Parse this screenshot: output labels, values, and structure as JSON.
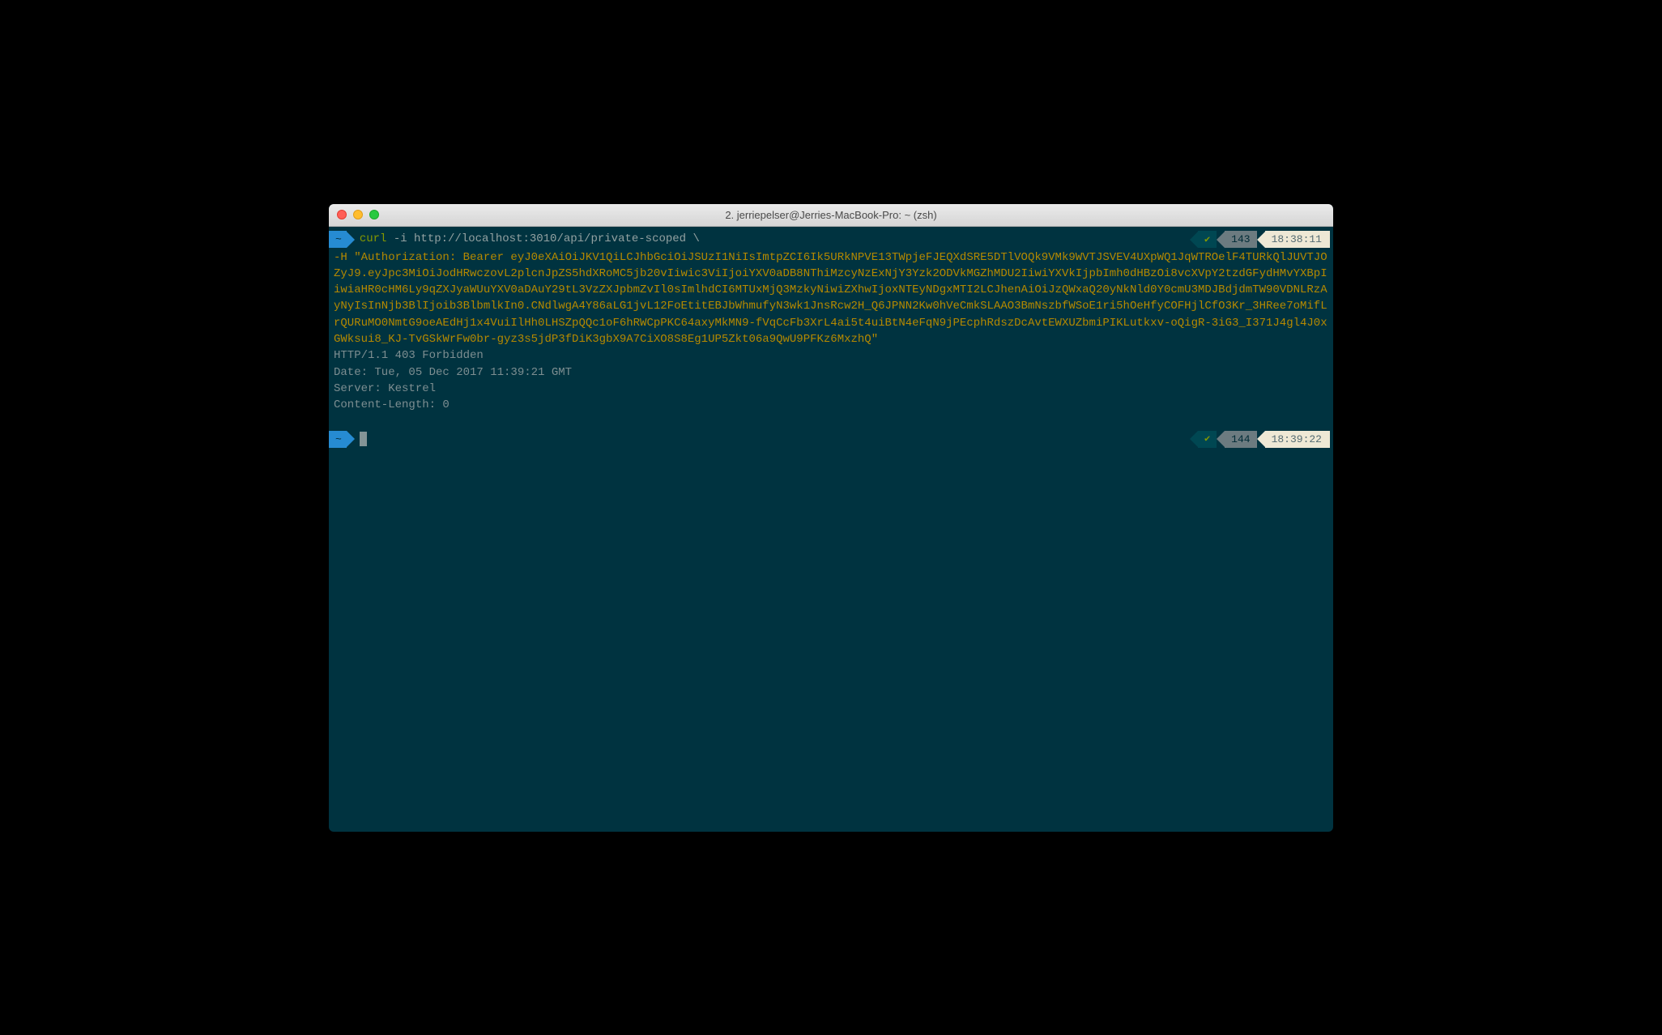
{
  "window": {
    "title": "2. jerriepelser@Jerries-MacBook-Pro: ~ (zsh)"
  },
  "prompt1": {
    "cwd": "~",
    "command_name": "curl",
    "command_args": " -i http://localhost:3010/api/private-scoped \\",
    "check": "✔",
    "history_num": "143",
    "time": "18:38:11"
  },
  "continuation": "-H \"Authorization: Bearer eyJ0eXAiOiJKV1QiLCJhbGciOiJSUzI1NiIsImtpZCI6Ik5URkNPVE13TWpjeFJEQXdSRE5DTlVOQk9VMk9WVTJSVEV4UXpWQ1JqWTROelF4TURkQlJUVTJOZyJ9.eyJpc3MiOiJodHRwczovL2plcnJpZS5hdXRoMC5jb20vIiwic3ViIjoiYXV0aDB8NThiMzcyNzExNjY3Yzk2ODVkMGZhMDU2IiwiYXVkIjpbImh0dHBzOi8vcXVpY2tzdGFydHMvYXBpIiwiaHR0cHM6Ly9qZXJyaWUuYXV0aDAuY29tL3VzZXJpbmZvIl0sImlhdCI6MTUxMjQ3MzkyNiwiZXhwIjoxNTEyNDgxMTI2LCJhenAiOiJzQWxaQ20yNkNld0Y0cmU3MDJBdjdmTW90VDNLRzAyNyIsInNjb3BlIjoib3BlbmlkIn0.CNdlwgA4Y86aLG1jvL12FoEtitEBJbWhmufyN3wk1JnsRcw2H_Q6JPNN2Kw0hVeCmkSLAAO3BmNszbfWSoE1ri5hOeHfyCOFHjlCfO3Kr_3HRee7oMifLrQURuMO0NmtG9oeAEdHj1x4VuiIlHh0LHSZpQQc1oF6hRWCpPKC64axyMkMN9-fVqCcFb3XrL4ai5t4uiBtN4eFqN9jPEcphRdszDcAvtEWXUZbmiPIKLutkxv-oQigR-3iG3_I371J4gl4J0xGWksui8_KJ-TvGSkWrFw0br-gyz3s5jdP3fDiK3gbX9A7CiXO8S8Eg1UP5Zkt06a9QwU9PFKz6MxzhQ\"",
  "response": [
    "HTTP/1.1 403 Forbidden",
    "Date: Tue, 05 Dec 2017 11:39:21 GMT",
    "Server: Kestrel",
    "Content-Length: 0"
  ],
  "prompt2": {
    "cwd": "~",
    "check": "✔",
    "history_num": "144",
    "time": "18:39:22"
  }
}
